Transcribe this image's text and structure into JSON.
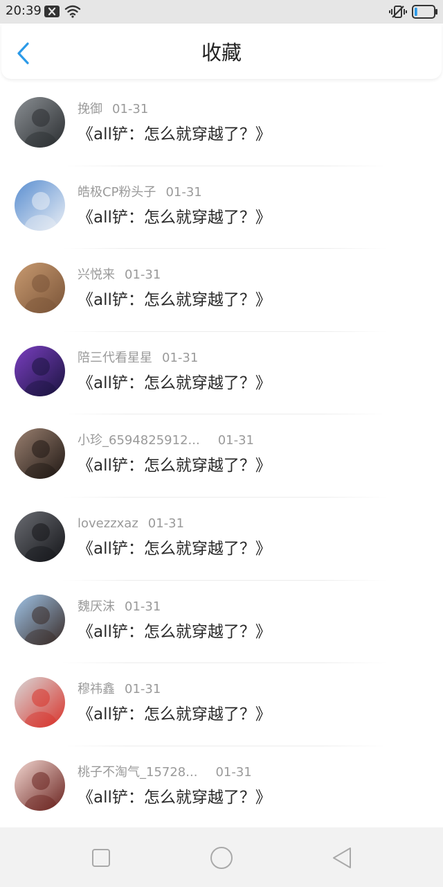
{
  "status_bar": {
    "time": "20:39",
    "icons": [
      "notification-x-icon",
      "wifi-icon",
      "vibrate-mute-icon",
      "battery-icon"
    ],
    "battery_level": 0.12
  },
  "header": {
    "back_icon": "chevron-left-icon",
    "title": "收藏",
    "accent_color": "#2b9ae8"
  },
  "items": [
    {
      "user": "挽御",
      "date": "01-31",
      "title": "《all铲：怎么就穿越了？》",
      "avatar_colors": [
        "#8a8f93",
        "#2b2e31"
      ]
    },
    {
      "user": "皓极CP粉头子",
      "date": "01-31",
      "title": "《all铲：怎么就穿越了？》",
      "avatar_colors": [
        "#5a8ed0",
        "#e9eef5"
      ]
    },
    {
      "user": "兴悦来",
      "date": "01-31",
      "title": "《all铲：怎么就穿越了？》",
      "avatar_colors": [
        "#c89a70",
        "#7a5438"
      ]
    },
    {
      "user": "陪三代看星星",
      "date": "01-31",
      "title": "《all铲：怎么就穿越了？》",
      "avatar_colors": [
        "#7a3fc0",
        "#1b1440"
      ]
    },
    {
      "user": "小珍_6594825912...",
      "date": "01-31",
      "title": "《all铲：怎么就穿越了？》",
      "avatar_colors": [
        "#9a8070",
        "#201814"
      ]
    },
    {
      "user": "lovezzxaz",
      "date": "01-31",
      "title": "《all铲：怎么就穿越了？》",
      "avatar_colors": [
        "#6a6c72",
        "#15161a"
      ]
    },
    {
      "user": "魏厌沫",
      "date": "01-31",
      "title": "《all铲：怎么就穿越了？》",
      "avatar_colors": [
        "#9fc3e6",
        "#3a2c28"
      ]
    },
    {
      "user": "穆祎鑫",
      "date": "01-31",
      "title": "《all铲：怎么就穿越了？》",
      "avatar_colors": [
        "#d8d8d8",
        "#d8342c"
      ]
    },
    {
      "user": "桃子不淘气_15728...",
      "date": "01-31",
      "title": "《all铲：怎么就穿越了？》",
      "avatar_colors": [
        "#f2d6d0",
        "#6a2420"
      ]
    }
  ],
  "nav_bar": {
    "buttons": [
      "recents-square-icon",
      "home-circle-icon",
      "back-triangle-icon"
    ]
  }
}
